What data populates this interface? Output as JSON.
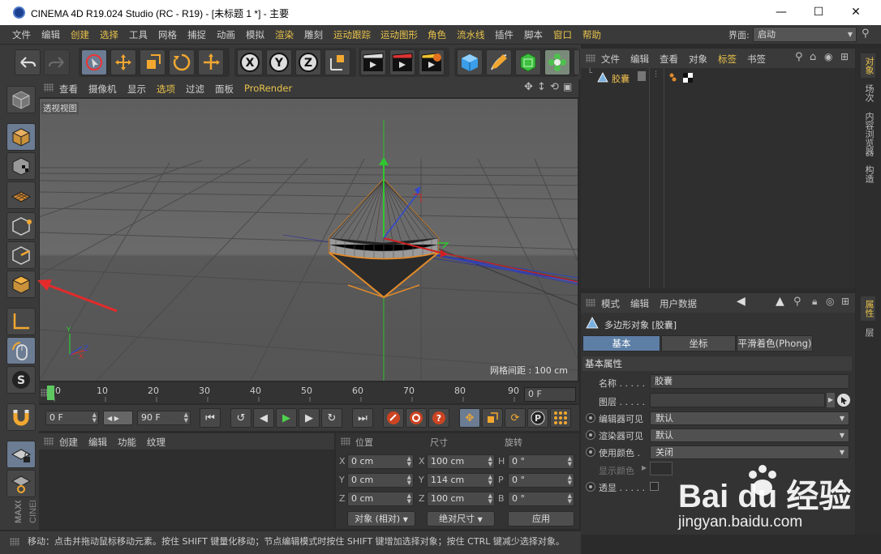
{
  "window": {
    "title": "CINEMA 4D R19.024 Studio (RC - R19) - [未标题 1 *] - 主要",
    "minimize": "—",
    "maximize": "☐",
    "close": "✕"
  },
  "menubar": {
    "items": [
      "文件",
      "编辑",
      "创建",
      "选择",
      "工具",
      "网格",
      "捕捉",
      "动画",
      "模拟",
      "渲染",
      "雕刻",
      "运动跟踪",
      "运动图形",
      "角色",
      "流水线",
      "插件",
      "脚本",
      "窗口",
      "帮助"
    ],
    "layout_label": "界面:",
    "layout_value": "启动"
  },
  "viewport": {
    "menu": [
      "查看",
      "摄像机",
      "显示",
      "选项",
      "过滤",
      "面板",
      "ProRender"
    ],
    "label": "透视视图",
    "grid_spacing": "网格间距 : 100 cm",
    "axis_y": "Y",
    "axis_z": "Z",
    "axis_x": "X"
  },
  "timeline": {
    "ticks": [
      "0",
      "10",
      "20",
      "30",
      "40",
      "50",
      "60",
      "70",
      "80",
      "90"
    ],
    "current_frame": "0 F"
  },
  "transport": {
    "start_frame": "0 F",
    "end_frame": "90 F"
  },
  "material_manager": {
    "menu": [
      "创建",
      "编辑",
      "功能",
      "纹理"
    ]
  },
  "coordinates": {
    "headers": [
      "位置",
      "尺寸",
      "旋转"
    ],
    "rows": [
      {
        "pos_axis": "X",
        "pos": "0 cm",
        "size_axis": "X",
        "size": "100 cm",
        "rot_axis": "H",
        "rot": "0 °"
      },
      {
        "pos_axis": "Y",
        "pos": "0 cm",
        "size_axis": "Y",
        "size": "114 cm",
        "rot_axis": "P",
        "rot": "0 °"
      },
      {
        "pos_axis": "Z",
        "pos": "0 cm",
        "size_axis": "Z",
        "size": "100 cm",
        "rot_axis": "B",
        "rot": "0 °"
      }
    ],
    "mode": "对象 (相对)",
    "size_mode": "绝对尺寸",
    "apply": "应用"
  },
  "status": {
    "text": "移动：点击并拖动鼠标移动元素。按住 SHIFT 键量化移动；节点编辑模式时按住 SHIFT 键增加选择对象；按住 CTRL 键减少选择对象。"
  },
  "object_manager": {
    "menu": [
      "文件",
      "编辑",
      "查看",
      "对象",
      "标签",
      "书签"
    ],
    "object_name": "胶囊"
  },
  "attributes": {
    "menu": [
      "模式",
      "编辑",
      "用户数据"
    ],
    "object_title": "多边形对象 [胶囊]",
    "tabs": [
      "基本",
      "坐标",
      "平滑着色(Phong)"
    ],
    "section": "基本属性",
    "props": {
      "name_label": "名称 . . . . .",
      "name_value": "胶囊",
      "layer_label": "图层 . . . . .",
      "editor_label": "编辑器可见",
      "editor_value": "默认",
      "render_label": "渲染器可见",
      "render_value": "默认",
      "usecolor_label": "使用颜色 .",
      "usecolor_value": "关闭",
      "displaycolor_label": "显示颜色",
      "xray_label": "透显 . . . . ."
    }
  },
  "right_tabs": [
    "对象",
    "场次",
    "内容浏览器",
    "构造",
    "属性",
    "层"
  ],
  "watermark": {
    "main": "Bai du 经验",
    "sub": "jingyan.baidu.com"
  },
  "colors": {
    "accent": "#e9c34b",
    "selection_outline": "#e08a2c",
    "active_tab": "#5d7ea5"
  }
}
